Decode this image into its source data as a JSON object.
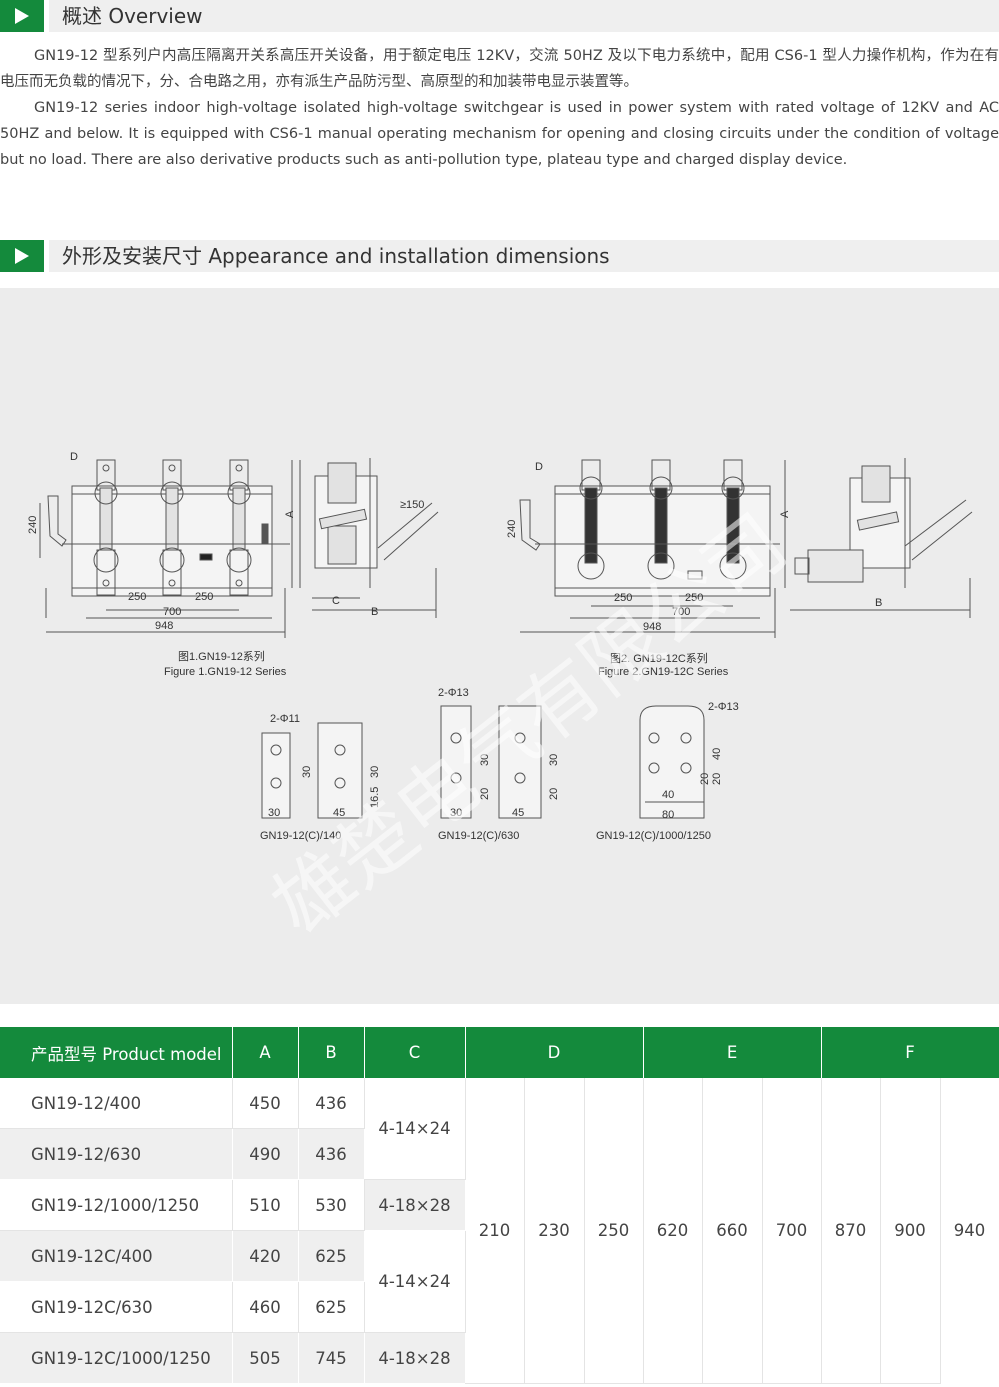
{
  "section1": {
    "title": "概述 Overview"
  },
  "overview": {
    "cn": "GN19-12 型系列户内高压隔离开关系高压开关设备，用于额定电压 12KV，交流 50HZ 及以下电力系统中，配用 CS6-1 型人力操作机构，作为在有电压而无负载的情况下，分、合电路之用，亦有派生产品防污型、高原型的和加装带电显示装置等。",
    "en": "GN19-12 series indoor high-voltage isolated high-voltage switchgear is used in power system with rated voltage of 12KV and AC 50HZ and below. It is equipped with CS6-1 manual operating mechanism for opening and closing circuits under the condition of voltage but no load. There are also derivative products such as anti-pollution type, plateau type and charged display device."
  },
  "section2": {
    "title": "外形及安装尺寸 Appearance and installation dimensions"
  },
  "figures": {
    "fig1_cn": "图1.GN19-12系列",
    "fig1_en": "Figure 1.GN19-12 Series",
    "fig2_cn": "图2. GN19-12C系列",
    "fig2_en": "Figure 2.GN19-12C Series",
    "dims": {
      "d240": "240",
      "d250": "250",
      "d700": "700",
      "d948": "948",
      "dA": "A",
      "dB": "B",
      "dC": "C",
      "dD": "D",
      "d150": "≥150"
    },
    "details": [
      {
        "model": "GN19-12(C)/140",
        "hole": "2-Φ11",
        "w1": "30",
        "w2": "45",
        "h1": "30",
        "h2": "30",
        "h3": "16.5"
      },
      {
        "model": "GN19-12(C)/630",
        "hole": "2-Φ13",
        "w1": "30",
        "w2": "45",
        "h1": "30",
        "h2": "20",
        "h3": "30",
        "h4": "20"
      },
      {
        "model": "GN19-12(C)/1000/1250",
        "hole": "2-Φ13",
        "w1": "40",
        "w2": "80",
        "h1": "40",
        "h2": "20",
        "h3": "20"
      }
    ],
    "watermark": "雄楚电气有限公司"
  },
  "table": {
    "headers": {
      "model": "产品型号 Product model",
      "A": "A",
      "B": "B",
      "C": "C",
      "D": "D",
      "E": "E",
      "F": "F"
    },
    "rows": [
      {
        "model": "GN19-12/400",
        "A": "450",
        "B": "436"
      },
      {
        "model": "GN19-12/630",
        "A": "490",
        "B": "436"
      },
      {
        "model": "GN19-12/1000/1250",
        "A": "510",
        "B": "530"
      },
      {
        "model": "GN19-12C/400",
        "A": "420",
        "B": "625"
      },
      {
        "model": "GN19-12C/630",
        "A": "460",
        "B": "625"
      },
      {
        "model": "GN19-12C/1000/1250",
        "A": "505",
        "B": "745"
      }
    ],
    "c_values": [
      "4-14×24",
      "4-18×28",
      "4-14×24",
      "4-18×28"
    ],
    "d_values": [
      "210",
      "230",
      "250"
    ],
    "e_values": [
      "620",
      "660",
      "700"
    ],
    "f_values": [
      "870",
      "900",
      "940"
    ]
  },
  "colors": {
    "accent": "#148a3c",
    "header_bg": "#efefef"
  }
}
